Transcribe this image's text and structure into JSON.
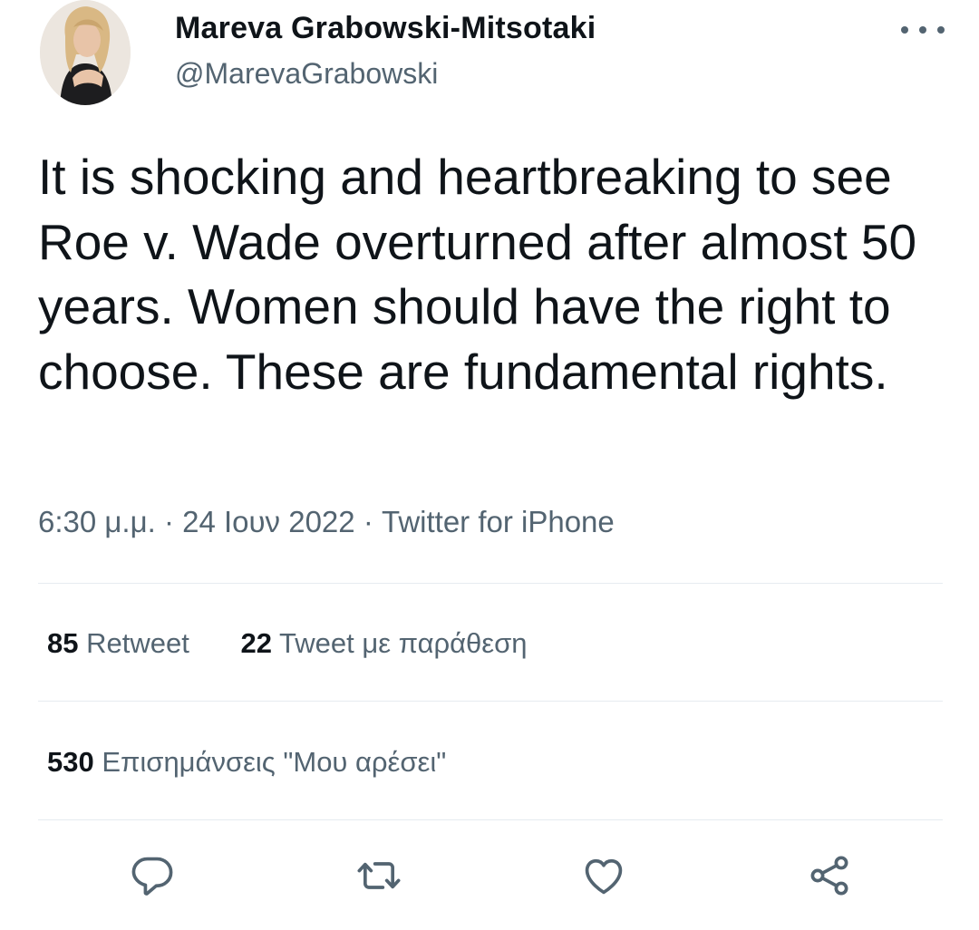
{
  "tweet": {
    "author": {
      "display_name": "Mareva Grabowski-Mitsotaki",
      "handle": "@MarevaGrabowski"
    },
    "text": "It is shocking and heartbreaking to see Roe v. Wade overturned after almost 50 years. Women should have the right to choose. These are fundamental rights.",
    "time": "6:30 μ.μ.",
    "separator": "·",
    "date": "24 Ιουν 2022",
    "source": "Twitter for iPhone"
  },
  "stats": {
    "retweets": {
      "count": "85",
      "label": "Retweet"
    },
    "quotes": {
      "count": "22",
      "label": "Tweet με παράθεση"
    },
    "likes": {
      "count": "530",
      "label": "Επισημάνσεις \"Μου αρέσει\""
    }
  },
  "icons": {
    "more": "more-icon",
    "reply": "reply-icon",
    "retweet": "retweet-icon",
    "like": "heart-icon",
    "share": "share-icon"
  },
  "colors": {
    "text": "#0f1419",
    "secondary": "#536471",
    "divider": "#e6ecf0"
  }
}
